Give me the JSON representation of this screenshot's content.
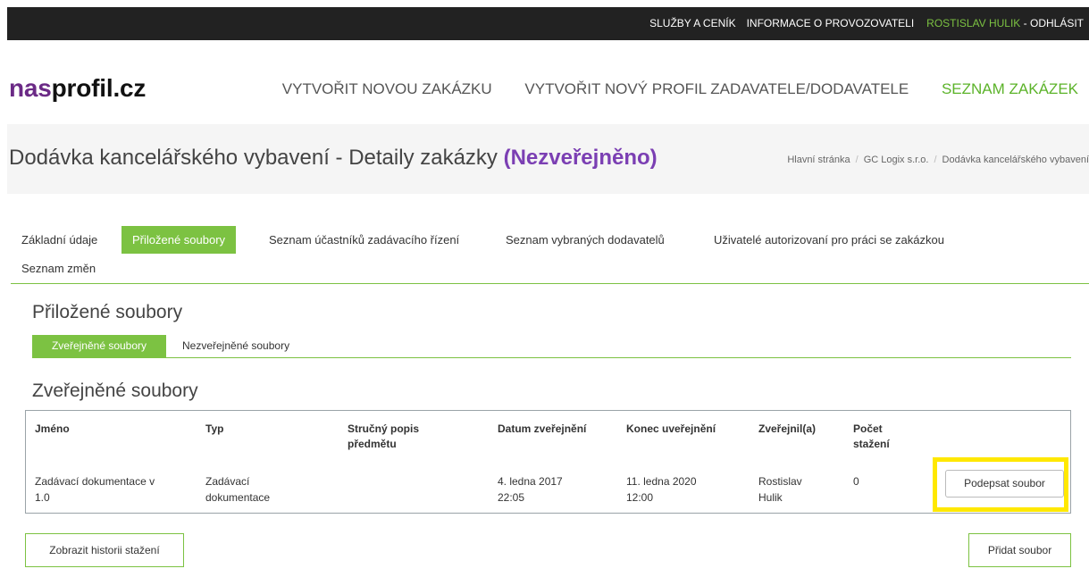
{
  "topbar": {
    "services": "SLUŽBY A CENÍK",
    "info": "INFORMACE O PROVOZOVATELI",
    "user": "ROSTISLAV HULIK",
    "separator": " - ",
    "logout": "ODHLÁSIT"
  },
  "logo": {
    "part1": "nas",
    "part2": "profil.cz"
  },
  "mainnav": {
    "create_tender": "VYTVOŘIT NOVOU ZAKÁZKU",
    "create_profile": "VYTVOŘIT NOVÝ PROFIL ZADAVATELE/DODAVATELE",
    "tender_list": "SEZNAM ZAKÁZEK"
  },
  "page": {
    "title": "Dodávka kancelářského vybavení - Detaily zakázky ",
    "status": "(Nezveřejněno)"
  },
  "breadcrumb": [
    "Hlavní stránka",
    "GC Logix s.r.o.",
    "Dodávka kancelářského vybavení"
  ],
  "breadcrumb_sep": "/",
  "tabs": {
    "basic": "Základní údaje",
    "attached": "Přiložené soubory",
    "participants": "Seznam účastníků zadávacího řízení",
    "selected": "Seznam vybraných dodavatelů",
    "authorized": "Uživatelé autorizovaní pro práci se zakázkou",
    "changes": "Seznam změn"
  },
  "section_title": "Přiložené soubory",
  "subtabs": {
    "published": "Zveřejněné soubory",
    "unpublished": "Nezveřejněné soubory"
  },
  "table_title": "Zveřejněné soubory",
  "table": {
    "headers": {
      "name": "Jméno",
      "type": "Typ",
      "desc_1": "Stručný popis",
      "desc_2": "předmětu",
      "published": "Datum zveřejnění",
      "end": "Konec uveřejnění",
      "by": "Zveřejnil(a)",
      "count_1": "Počet",
      "count_2": "stažení"
    },
    "rows": [
      {
        "name_1": "Zadávací dokumentace v",
        "name_2": "1.0",
        "type_1": "Zadávací",
        "type_2": "dokumentace",
        "desc": "",
        "published_1": "4. ledna 2017",
        "published_2": "22:05",
        "end_1": "11. ledna 2020",
        "end_2": "12:00",
        "by_1": "Rostislav",
        "by_2": "Hulik",
        "count": "0",
        "action": "Podepsat soubor"
      }
    ]
  },
  "buttons": {
    "history": "Zobrazit historii stažení",
    "add_file": "Přidat soubor"
  },
  "colors": {
    "accent_green": "#7cc242",
    "status_purple": "#7b3fb3",
    "logo_purple": "#6b2a86",
    "highlight_yellow": "#ffe800",
    "topbar_bg": "#222222"
  }
}
